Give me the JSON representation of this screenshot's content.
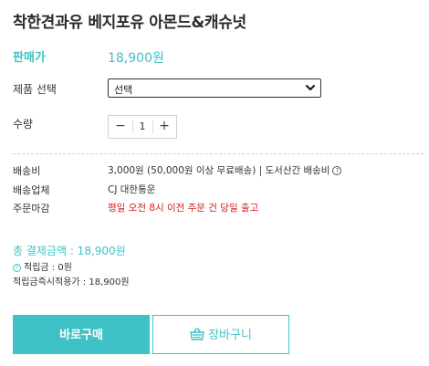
{
  "product": {
    "title": "착한견과유 베지포유 아몬드&캐슈넛"
  },
  "price": {
    "label": "판매가",
    "value": "18,900원"
  },
  "option": {
    "label": "제품 선택",
    "selected": "선택"
  },
  "quantity": {
    "label": "수량",
    "minus": "−",
    "value": "1",
    "plus": "+"
  },
  "shipping": {
    "fee_label": "배송비",
    "fee_value": "3,000원 (50,000원 이상 무료배송)  |  도서산간 배송비",
    "carrier_label": "배송업체",
    "carrier_value": "CJ 대한통운",
    "deadline_label": "주문마감",
    "deadline_value": "평일 오전 8시 이전 주문 건 당일 출고"
  },
  "summary": {
    "total": "총 결제금액 : 18,900원",
    "points": "적립금 : 0원",
    "instant_points": "적립금즉시적용가 : 18,900원"
  },
  "buttons": {
    "buy": "바로구매",
    "cart": "장바구니"
  },
  "colors": {
    "accent": "#3ec2c6",
    "deadline": "#d31b1b"
  },
  "icons": {
    "help": "question-circle-icon",
    "select": "chevron-down-icon",
    "cart": "basket-icon"
  }
}
